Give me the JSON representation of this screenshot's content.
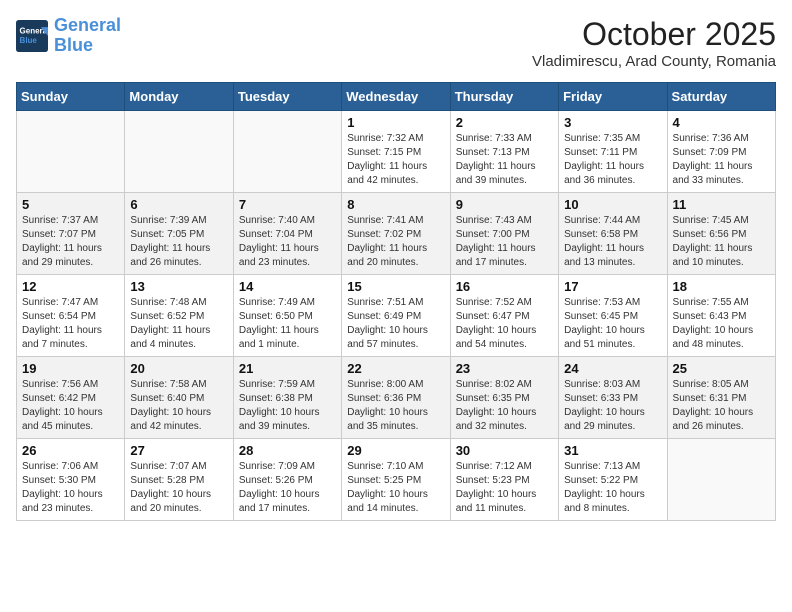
{
  "header": {
    "logo_line1": "General",
    "logo_line2": "Blue",
    "month_year": "October 2025",
    "location": "Vladimirescu, Arad County, Romania"
  },
  "weekdays": [
    "Sunday",
    "Monday",
    "Tuesday",
    "Wednesday",
    "Thursday",
    "Friday",
    "Saturday"
  ],
  "weeks": [
    [
      {
        "day": "",
        "info": ""
      },
      {
        "day": "",
        "info": ""
      },
      {
        "day": "",
        "info": ""
      },
      {
        "day": "1",
        "info": "Sunrise: 7:32 AM\nSunset: 7:15 PM\nDaylight: 11 hours and 42 minutes."
      },
      {
        "day": "2",
        "info": "Sunrise: 7:33 AM\nSunset: 7:13 PM\nDaylight: 11 hours and 39 minutes."
      },
      {
        "day": "3",
        "info": "Sunrise: 7:35 AM\nSunset: 7:11 PM\nDaylight: 11 hours and 36 minutes."
      },
      {
        "day": "4",
        "info": "Sunrise: 7:36 AM\nSunset: 7:09 PM\nDaylight: 11 hours and 33 minutes."
      }
    ],
    [
      {
        "day": "5",
        "info": "Sunrise: 7:37 AM\nSunset: 7:07 PM\nDaylight: 11 hours and 29 minutes."
      },
      {
        "day": "6",
        "info": "Sunrise: 7:39 AM\nSunset: 7:05 PM\nDaylight: 11 hours and 26 minutes."
      },
      {
        "day": "7",
        "info": "Sunrise: 7:40 AM\nSunset: 7:04 PM\nDaylight: 11 hours and 23 minutes."
      },
      {
        "day": "8",
        "info": "Sunrise: 7:41 AM\nSunset: 7:02 PM\nDaylight: 11 hours and 20 minutes."
      },
      {
        "day": "9",
        "info": "Sunrise: 7:43 AM\nSunset: 7:00 PM\nDaylight: 11 hours and 17 minutes."
      },
      {
        "day": "10",
        "info": "Sunrise: 7:44 AM\nSunset: 6:58 PM\nDaylight: 11 hours and 13 minutes."
      },
      {
        "day": "11",
        "info": "Sunrise: 7:45 AM\nSunset: 6:56 PM\nDaylight: 11 hours and 10 minutes."
      }
    ],
    [
      {
        "day": "12",
        "info": "Sunrise: 7:47 AM\nSunset: 6:54 PM\nDaylight: 11 hours and 7 minutes."
      },
      {
        "day": "13",
        "info": "Sunrise: 7:48 AM\nSunset: 6:52 PM\nDaylight: 11 hours and 4 minutes."
      },
      {
        "day": "14",
        "info": "Sunrise: 7:49 AM\nSunset: 6:50 PM\nDaylight: 11 hours and 1 minute."
      },
      {
        "day": "15",
        "info": "Sunrise: 7:51 AM\nSunset: 6:49 PM\nDaylight: 10 hours and 57 minutes."
      },
      {
        "day": "16",
        "info": "Sunrise: 7:52 AM\nSunset: 6:47 PM\nDaylight: 10 hours and 54 minutes."
      },
      {
        "day": "17",
        "info": "Sunrise: 7:53 AM\nSunset: 6:45 PM\nDaylight: 10 hours and 51 minutes."
      },
      {
        "day": "18",
        "info": "Sunrise: 7:55 AM\nSunset: 6:43 PM\nDaylight: 10 hours and 48 minutes."
      }
    ],
    [
      {
        "day": "19",
        "info": "Sunrise: 7:56 AM\nSunset: 6:42 PM\nDaylight: 10 hours and 45 minutes."
      },
      {
        "day": "20",
        "info": "Sunrise: 7:58 AM\nSunset: 6:40 PM\nDaylight: 10 hours and 42 minutes."
      },
      {
        "day": "21",
        "info": "Sunrise: 7:59 AM\nSunset: 6:38 PM\nDaylight: 10 hours and 39 minutes."
      },
      {
        "day": "22",
        "info": "Sunrise: 8:00 AM\nSunset: 6:36 PM\nDaylight: 10 hours and 35 minutes."
      },
      {
        "day": "23",
        "info": "Sunrise: 8:02 AM\nSunset: 6:35 PM\nDaylight: 10 hours and 32 minutes."
      },
      {
        "day": "24",
        "info": "Sunrise: 8:03 AM\nSunset: 6:33 PM\nDaylight: 10 hours and 29 minutes."
      },
      {
        "day": "25",
        "info": "Sunrise: 8:05 AM\nSunset: 6:31 PM\nDaylight: 10 hours and 26 minutes."
      }
    ],
    [
      {
        "day": "26",
        "info": "Sunrise: 7:06 AM\nSunset: 5:30 PM\nDaylight: 10 hours and 23 minutes."
      },
      {
        "day": "27",
        "info": "Sunrise: 7:07 AM\nSunset: 5:28 PM\nDaylight: 10 hours and 20 minutes."
      },
      {
        "day": "28",
        "info": "Sunrise: 7:09 AM\nSunset: 5:26 PM\nDaylight: 10 hours and 17 minutes."
      },
      {
        "day": "29",
        "info": "Sunrise: 7:10 AM\nSunset: 5:25 PM\nDaylight: 10 hours and 14 minutes."
      },
      {
        "day": "30",
        "info": "Sunrise: 7:12 AM\nSunset: 5:23 PM\nDaylight: 10 hours and 11 minutes."
      },
      {
        "day": "31",
        "info": "Sunrise: 7:13 AM\nSunset: 5:22 PM\nDaylight: 10 hours and 8 minutes."
      },
      {
        "day": "",
        "info": ""
      }
    ]
  ]
}
